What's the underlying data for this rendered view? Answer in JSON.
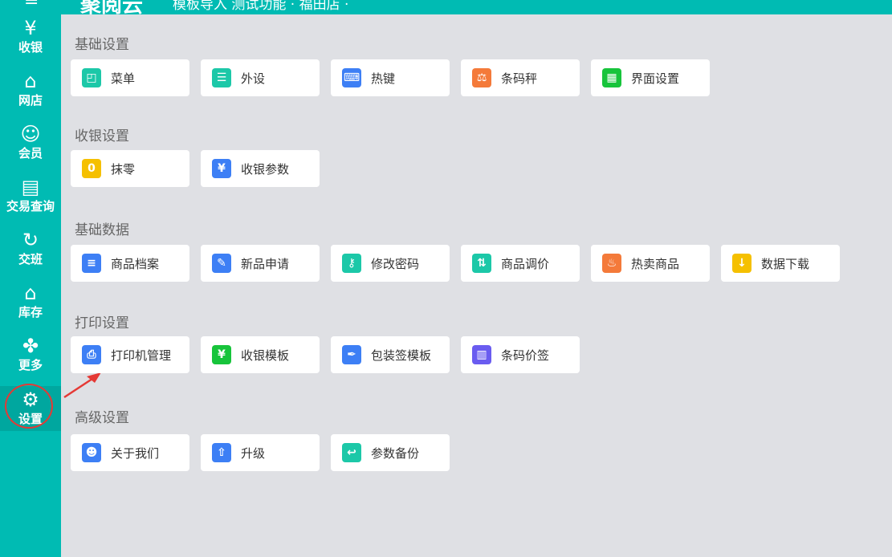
{
  "header": {
    "menu_icon": "menu-icon",
    "logo": "聚阅云",
    "info": "模板导入 测试功能 · 福田店 ·"
  },
  "sidebar": {
    "items": [
      {
        "label": "收银",
        "icon": "¥"
      },
      {
        "label": "网店",
        "icon": "⌂"
      },
      {
        "label": "会员",
        "icon": "☺"
      },
      {
        "label": "交易查询",
        "icon": "▤"
      },
      {
        "label": "交班",
        "icon": "↻"
      },
      {
        "label": "库存",
        "icon": "⌂"
      },
      {
        "label": "更多",
        "icon": "✤"
      },
      {
        "label": "设置",
        "icon": "⚙"
      }
    ],
    "active": "设置"
  },
  "sections": [
    {
      "title": "基础设置",
      "items": [
        {
          "label": "菜单",
          "icon": "menu-icon",
          "glyph": "◰",
          "color": "#1cc8a8"
        },
        {
          "label": "外设",
          "icon": "device-icon",
          "glyph": "☰",
          "color": "#1cc8a8"
        },
        {
          "label": "热键",
          "icon": "keyboard-icon",
          "glyph": "⌨",
          "color": "#3d7ff5"
        },
        {
          "label": "条码秤",
          "icon": "scale-icon",
          "glyph": "⚖",
          "color": "#f47a3a"
        },
        {
          "label": "界面设置",
          "icon": "layout-icon",
          "glyph": "▦",
          "color": "#17c43b"
        }
      ]
    },
    {
      "title": "收银设置",
      "items": [
        {
          "label": "抹零",
          "icon": "round-off-icon",
          "glyph": "0",
          "color": "#f5c000"
        },
        {
          "label": "收银参数",
          "icon": "cashier-params-icon",
          "glyph": "¥",
          "color": "#3d7ff5"
        }
      ]
    },
    {
      "title": "基础数据",
      "items": [
        {
          "label": "商品档案",
          "icon": "product-file-icon",
          "glyph": "≡",
          "color": "#3d7ff5"
        },
        {
          "label": "新品申请",
          "icon": "new-product-icon",
          "glyph": "✎",
          "color": "#3d7ff5"
        },
        {
          "label": "修改密码",
          "icon": "key-icon",
          "glyph": "⚷",
          "color": "#1cc8a8"
        },
        {
          "label": "商品调价",
          "icon": "price-adjust-icon",
          "glyph": "⇅",
          "color": "#1cc8a8"
        },
        {
          "label": "热卖商品",
          "icon": "fire-icon",
          "glyph": "♨",
          "color": "#f47a3a"
        },
        {
          "label": "数据下载",
          "icon": "download-icon",
          "glyph": "↓",
          "color": "#f5c000"
        }
      ]
    },
    {
      "title": "打印设置",
      "items": [
        {
          "label": "打印机管理",
          "icon": "printer-icon",
          "glyph": "⎙",
          "color": "#3d7ff5"
        },
        {
          "label": "收银模板",
          "icon": "cashier-template-icon",
          "glyph": "¥",
          "color": "#17c43b"
        },
        {
          "label": "包装签模板",
          "icon": "feather-icon",
          "glyph": "✒",
          "color": "#3d7ff5"
        },
        {
          "label": "条码价签",
          "icon": "barcode-icon",
          "glyph": "▥",
          "color": "#6a5cf0"
        }
      ]
    },
    {
      "title": "高级设置",
      "items": [
        {
          "label": "关于我们",
          "icon": "users-icon",
          "glyph": "☻",
          "color": "#3d7ff5"
        },
        {
          "label": "升级",
          "icon": "upgrade-icon",
          "glyph": "⇧",
          "color": "#3d7ff5"
        },
        {
          "label": "参数备份",
          "icon": "backup-icon",
          "glyph": "↩",
          "color": "#1cc8a8"
        }
      ]
    }
  ]
}
